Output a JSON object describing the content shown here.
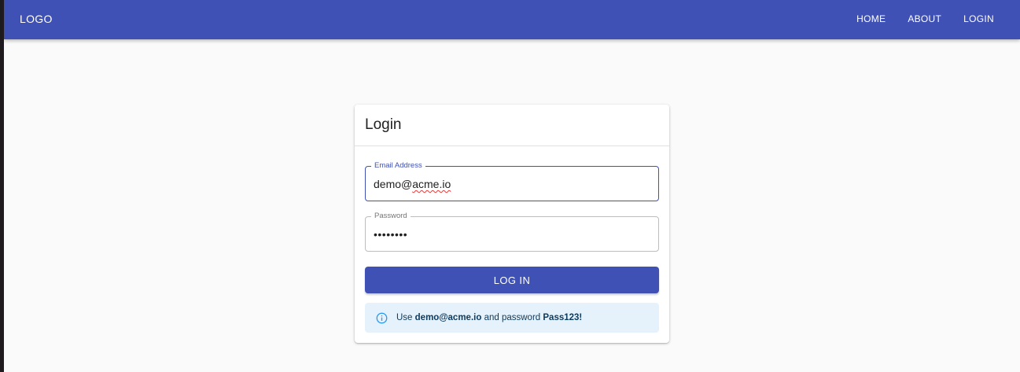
{
  "appbar": {
    "logo": "LOGO",
    "nav": [
      {
        "label": "HOME"
      },
      {
        "label": "ABOUT"
      },
      {
        "label": "LOGIN"
      }
    ],
    "color": "#3f51b5"
  },
  "card": {
    "title": "Login",
    "email": {
      "label": "Email Address",
      "prefix": "demo@",
      "domain": "acme.io",
      "value": "demo@acme.io"
    },
    "password": {
      "label": "Password",
      "value": "Pass123!",
      "masked": "••••••••"
    },
    "login_button": "LOG IN",
    "hint": {
      "icon": "info-icon",
      "text_1": "Use ",
      "email": "demo@acme.io",
      "text_2": " and password ",
      "password": "Pass123!"
    }
  },
  "colors": {
    "primary": "#3f51b5",
    "info_bg": "#e5f2fc",
    "info_icon": "#2196f3"
  }
}
